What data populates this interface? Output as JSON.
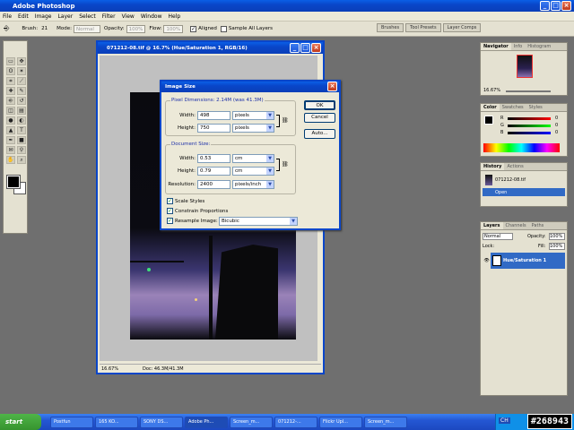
{
  "app": {
    "title": "Adobe Photoshop"
  },
  "menu": [
    "File",
    "Edit",
    "Image",
    "Layer",
    "Select",
    "Filter",
    "View",
    "Window",
    "Help"
  ],
  "options": {
    "brush_label": "Brush:",
    "brush_size": "21",
    "mode_label": "Mode:",
    "mode_value": "Normal",
    "opacity_label": "Opacity:",
    "opacity_value": "100%",
    "flow_label": "Flow:",
    "flow_value": "100%",
    "aligned_label": "Aligned",
    "sample_label": "Sample All Layers"
  },
  "well_tabs": [
    "Brushes",
    "Tool Presets",
    "Layer Comps"
  ],
  "document": {
    "title": "071212-08.tif @ 16.7% (Hue/Saturation 1, RGB/16)",
    "zoom": "16.67%",
    "doc_size": "Doc: 46.3M/41.3M"
  },
  "dialog": {
    "title": "Image Size",
    "pixel_dims": "Pixel Dimensions:  2.14M (was 41.3M)",
    "width_label": "Width:",
    "width_value": "498",
    "width_unit": "pixels",
    "height_label": "Height:",
    "height_value": "750",
    "height_unit": "pixels",
    "doc_size_label": "Document Size:",
    "doc_width_value": "0.53",
    "doc_width_unit": "cm",
    "doc_height_value": "0.79",
    "doc_height_unit": "cm",
    "resolution_label": "Resolution:",
    "resolution_value": "2400",
    "resolution_unit": "pixels/inch",
    "ok": "OK",
    "cancel": "Cancel",
    "auto": "Auto...",
    "scale_styles": "Scale Styles",
    "constrain": "Constrain Proportions",
    "resample": "Resample Image:",
    "resample_method": "Bicubic"
  },
  "navigator": {
    "tabs": [
      "Navigator",
      "Info",
      "Histogram"
    ],
    "zoom": "16.67%"
  },
  "color": {
    "tabs": [
      "Color",
      "Swatches",
      "Styles"
    ],
    "r": "R",
    "g": "G",
    "b": "B",
    "r_val": "0",
    "g_val": "0",
    "b_val": "0"
  },
  "history": {
    "tabs": [
      "History",
      "Actions"
    ],
    "snapshot": "071212-08.tif",
    "step": "Open"
  },
  "layers": {
    "tabs": [
      "Layers",
      "Channels",
      "Paths"
    ],
    "blend": "Normal",
    "opacity_label": "Opacity:",
    "opacity_value": "100%",
    "lock_label": "Lock:",
    "fill_label": "Fill:",
    "fill_value": "100%",
    "layer_name": "Hue/Saturation 1"
  },
  "taskbar": {
    "start": "start",
    "items": [
      "Postfun",
      "165 KO...",
      "SONY DS...",
      "Adobe Ph...",
      "Screen_m...",
      "071212-...",
      "Flickr Upl...",
      "Screen_m..."
    ],
    "active_index": 3,
    "lang": "CH"
  },
  "badge": "#268943"
}
